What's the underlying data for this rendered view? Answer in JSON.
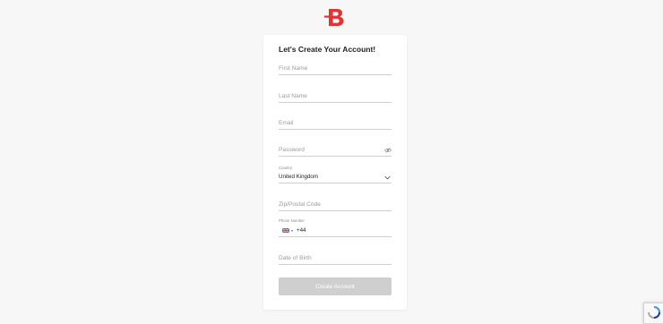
{
  "brand": {
    "logo_letter": "B",
    "accent": "#e63232"
  },
  "form": {
    "title": "Let's Create Your Account!",
    "first_name": {
      "placeholder": "First Name"
    },
    "last_name": {
      "placeholder": "Last Name"
    },
    "email": {
      "placeholder": "Email"
    },
    "password": {
      "placeholder": "Password"
    },
    "country": {
      "label": "Country",
      "value": "United Kingdom"
    },
    "zip": {
      "placeholder": "Zip/Postal Code"
    },
    "phone": {
      "label": "Phone Number",
      "dial_code": "+44"
    },
    "dob": {
      "placeholder": "Date of Birth"
    },
    "submit_label": "Create Account"
  },
  "icons": {
    "password_toggle": "eye-icon",
    "country_dropdown": "chevron-down-icon",
    "phone_flag": "uk-flag-icon",
    "captcha": "recaptcha-icon"
  },
  "colors": {
    "button_disabled": "#cfcfcf",
    "background": "#f7f7f7"
  }
}
